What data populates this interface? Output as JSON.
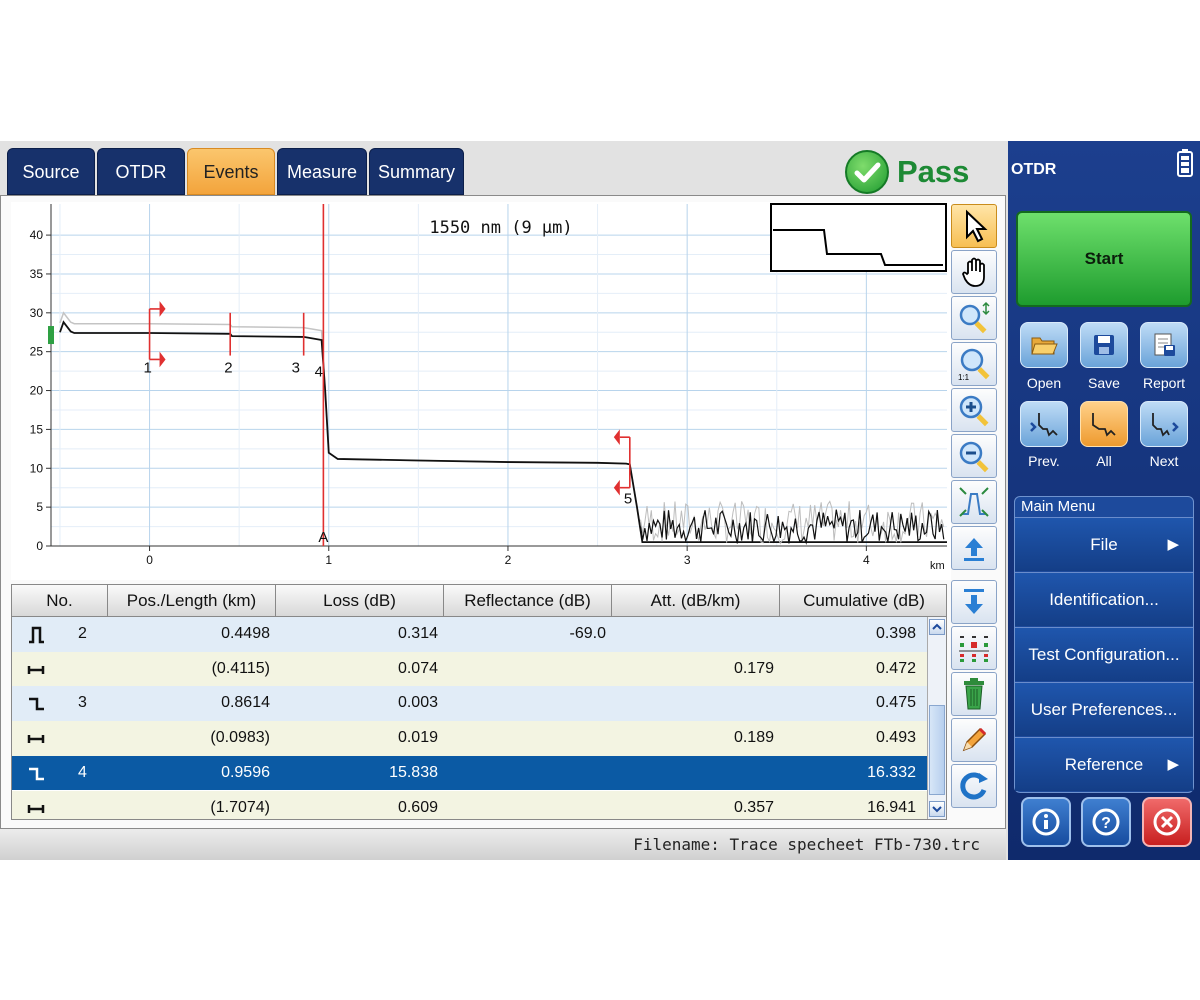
{
  "tabs": [
    {
      "label": "Source"
    },
    {
      "label": "OTDR"
    },
    {
      "label": "Events",
      "active": true
    },
    {
      "label": "Measure"
    },
    {
      "label": "Summary"
    }
  ],
  "status": {
    "result": "Pass",
    "color": "#1d8a35"
  },
  "graph": {
    "title": "1550 nm (9 µm)",
    "xunit": "km",
    "yticks": [
      "0",
      "5",
      "10",
      "15",
      "20",
      "25",
      "30",
      "35",
      "40"
    ],
    "xticks": [
      "0",
      "1",
      "2",
      "3",
      "4"
    ],
    "markers": [
      {
        "label": "1",
        "pos_km": 0.0
      },
      {
        "label": "2",
        "pos_km": 0.45
      },
      {
        "label": "3",
        "pos_km": 0.86
      },
      {
        "label": "4",
        "pos_km": 0.96
      },
      {
        "label": "5",
        "pos_km": 2.68
      }
    ],
    "cursor": {
      "label": "A",
      "pos_km": 0.97
    }
  },
  "chart_data": {
    "type": "line",
    "title": "1550 nm (9 µm)",
    "xlabel": "km",
    "xlim": [
      -0.55,
      4.45
    ],
    "ylim": [
      0,
      44
    ],
    "series": [
      {
        "x": [
          -0.5,
          -0.48,
          -0.46,
          -0.44,
          -0.42,
          0.0,
          0.45,
          0.46,
          0.86,
          0.96,
          0.98,
          1.0,
          1.05,
          1.5,
          2.0,
          2.5,
          2.66,
          2.68,
          2.72,
          2.75,
          4.45
        ],
        "values": [
          27.5,
          28.8,
          28.2,
          27.6,
          27.4,
          27.4,
          27.3,
          27.0,
          26.9,
          26.5,
          20.0,
          12.0,
          11.2,
          11.0,
          10.8,
          10.7,
          10.6,
          10.5,
          5.0,
          0.5,
          0.5
        ]
      }
    ]
  },
  "table": {
    "headers": [
      "No.",
      "Pos./Length (km)",
      "Loss (dB)",
      "Reflectance (dB)",
      "Att. (dB/km)",
      "Cumulative (dB)"
    ],
    "rows": [
      {
        "icon": "reflective-event-icon",
        "no": "2",
        "pos": "0.4498",
        "loss": "0.314",
        "refl": "-69.0",
        "att": "",
        "cum": "0.398"
      },
      {
        "icon": "fiber-section-icon",
        "no": "",
        "pos": "(0.4115)",
        "loss": "0.074",
        "refl": "",
        "att": "0.179",
        "cum": "0.472"
      },
      {
        "icon": "non-reflective-event-icon",
        "no": "3",
        "pos": "0.8614",
        "loss": "0.003",
        "refl": "",
        "att": "",
        "cum": "0.475"
      },
      {
        "icon": "fiber-section-icon",
        "no": "",
        "pos": "(0.0983)",
        "loss": "0.019",
        "refl": "",
        "att": "0.189",
        "cum": "0.493"
      },
      {
        "icon": "non-reflective-event-icon",
        "no": "4",
        "pos": "0.9596",
        "loss": "15.838",
        "refl": "",
        "att": "",
        "cum": "16.332",
        "selected": true
      },
      {
        "icon": "fiber-section-icon",
        "no": "",
        "pos": "(1.7074)",
        "loss": "0.609",
        "refl": "",
        "att": "0.357",
        "cum": "16.941"
      }
    ]
  },
  "filename": "Filename: Trace specheet FTb-730.trc",
  "sidebar": {
    "title": "OTDR",
    "start": "Start",
    "buttons": [
      {
        "label": "Open"
      },
      {
        "label": "Save"
      },
      {
        "label": "Report"
      },
      {
        "label": "Prev."
      },
      {
        "label": "All"
      },
      {
        "label": "Next"
      }
    ],
    "menu_title": "Main Menu",
    "menu": [
      {
        "label": "File",
        "arrow": true
      },
      {
        "label": "Identification..."
      },
      {
        "label": "Test Configuration..."
      },
      {
        "label": "User Preferences..."
      },
      {
        "label": "Reference",
        "arrow": true
      }
    ]
  }
}
